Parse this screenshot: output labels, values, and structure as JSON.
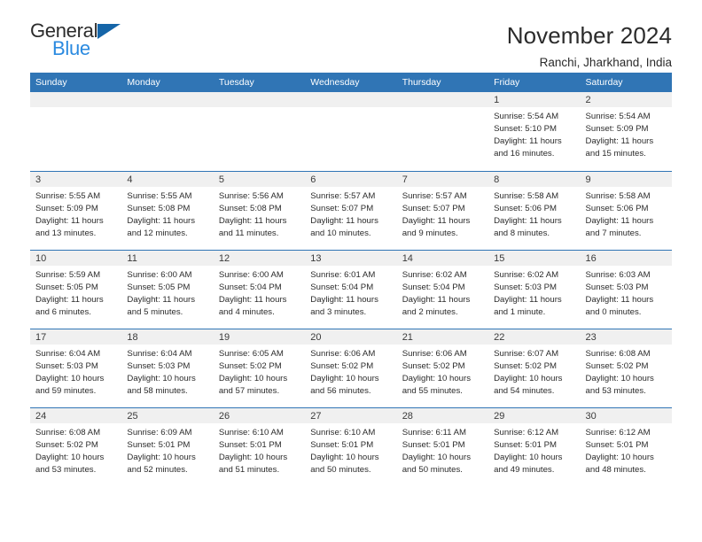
{
  "brand": {
    "name_part1": "General",
    "name_part2": "Blue",
    "triangle_color": "#1565a8",
    "blue_text_color": "#2b8ae0"
  },
  "header": {
    "title": "November 2024",
    "subtitle": "Ranchi, Jharkhand, India"
  },
  "theme": {
    "header_blue": "#3075b5",
    "daynum_band": "#f0f0f0",
    "text": "#2b2b2b"
  },
  "weekday_headers": [
    "Sunday",
    "Monday",
    "Tuesday",
    "Wednesday",
    "Thursday",
    "Friday",
    "Saturday"
  ],
  "weeks": [
    [
      {
        "day": "",
        "sunrise": "",
        "sunset": "",
        "daylight1": "",
        "daylight2": ""
      },
      {
        "day": "",
        "sunrise": "",
        "sunset": "",
        "daylight1": "",
        "daylight2": ""
      },
      {
        "day": "",
        "sunrise": "",
        "sunset": "",
        "daylight1": "",
        "daylight2": ""
      },
      {
        "day": "",
        "sunrise": "",
        "sunset": "",
        "daylight1": "",
        "daylight2": ""
      },
      {
        "day": "",
        "sunrise": "",
        "sunset": "",
        "daylight1": "",
        "daylight2": ""
      },
      {
        "day": "1",
        "sunrise": "Sunrise: 5:54 AM",
        "sunset": "Sunset: 5:10 PM",
        "daylight1": "Daylight: 11 hours",
        "daylight2": "and 16 minutes."
      },
      {
        "day": "2",
        "sunrise": "Sunrise: 5:54 AM",
        "sunset": "Sunset: 5:09 PM",
        "daylight1": "Daylight: 11 hours",
        "daylight2": "and 15 minutes."
      }
    ],
    [
      {
        "day": "3",
        "sunrise": "Sunrise: 5:55 AM",
        "sunset": "Sunset: 5:09 PM",
        "daylight1": "Daylight: 11 hours",
        "daylight2": "and 13 minutes."
      },
      {
        "day": "4",
        "sunrise": "Sunrise: 5:55 AM",
        "sunset": "Sunset: 5:08 PM",
        "daylight1": "Daylight: 11 hours",
        "daylight2": "and 12 minutes."
      },
      {
        "day": "5",
        "sunrise": "Sunrise: 5:56 AM",
        "sunset": "Sunset: 5:08 PM",
        "daylight1": "Daylight: 11 hours",
        "daylight2": "and 11 minutes."
      },
      {
        "day": "6",
        "sunrise": "Sunrise: 5:57 AM",
        "sunset": "Sunset: 5:07 PM",
        "daylight1": "Daylight: 11 hours",
        "daylight2": "and 10 minutes."
      },
      {
        "day": "7",
        "sunrise": "Sunrise: 5:57 AM",
        "sunset": "Sunset: 5:07 PM",
        "daylight1": "Daylight: 11 hours",
        "daylight2": "and 9 minutes."
      },
      {
        "day": "8",
        "sunrise": "Sunrise: 5:58 AM",
        "sunset": "Sunset: 5:06 PM",
        "daylight1": "Daylight: 11 hours",
        "daylight2": "and 8 minutes."
      },
      {
        "day": "9",
        "sunrise": "Sunrise: 5:58 AM",
        "sunset": "Sunset: 5:06 PM",
        "daylight1": "Daylight: 11 hours",
        "daylight2": "and 7 minutes."
      }
    ],
    [
      {
        "day": "10",
        "sunrise": "Sunrise: 5:59 AM",
        "sunset": "Sunset: 5:05 PM",
        "daylight1": "Daylight: 11 hours",
        "daylight2": "and 6 minutes."
      },
      {
        "day": "11",
        "sunrise": "Sunrise: 6:00 AM",
        "sunset": "Sunset: 5:05 PM",
        "daylight1": "Daylight: 11 hours",
        "daylight2": "and 5 minutes."
      },
      {
        "day": "12",
        "sunrise": "Sunrise: 6:00 AM",
        "sunset": "Sunset: 5:04 PM",
        "daylight1": "Daylight: 11 hours",
        "daylight2": "and 4 minutes."
      },
      {
        "day": "13",
        "sunrise": "Sunrise: 6:01 AM",
        "sunset": "Sunset: 5:04 PM",
        "daylight1": "Daylight: 11 hours",
        "daylight2": "and 3 minutes."
      },
      {
        "day": "14",
        "sunrise": "Sunrise: 6:02 AM",
        "sunset": "Sunset: 5:04 PM",
        "daylight1": "Daylight: 11 hours",
        "daylight2": "and 2 minutes."
      },
      {
        "day": "15",
        "sunrise": "Sunrise: 6:02 AM",
        "sunset": "Sunset: 5:03 PM",
        "daylight1": "Daylight: 11 hours",
        "daylight2": "and 1 minute."
      },
      {
        "day": "16",
        "sunrise": "Sunrise: 6:03 AM",
        "sunset": "Sunset: 5:03 PM",
        "daylight1": "Daylight: 11 hours",
        "daylight2": "and 0 minutes."
      }
    ],
    [
      {
        "day": "17",
        "sunrise": "Sunrise: 6:04 AM",
        "sunset": "Sunset: 5:03 PM",
        "daylight1": "Daylight: 10 hours",
        "daylight2": "and 59 minutes."
      },
      {
        "day": "18",
        "sunrise": "Sunrise: 6:04 AM",
        "sunset": "Sunset: 5:03 PM",
        "daylight1": "Daylight: 10 hours",
        "daylight2": "and 58 minutes."
      },
      {
        "day": "19",
        "sunrise": "Sunrise: 6:05 AM",
        "sunset": "Sunset: 5:02 PM",
        "daylight1": "Daylight: 10 hours",
        "daylight2": "and 57 minutes."
      },
      {
        "day": "20",
        "sunrise": "Sunrise: 6:06 AM",
        "sunset": "Sunset: 5:02 PM",
        "daylight1": "Daylight: 10 hours",
        "daylight2": "and 56 minutes."
      },
      {
        "day": "21",
        "sunrise": "Sunrise: 6:06 AM",
        "sunset": "Sunset: 5:02 PM",
        "daylight1": "Daylight: 10 hours",
        "daylight2": "and 55 minutes."
      },
      {
        "day": "22",
        "sunrise": "Sunrise: 6:07 AM",
        "sunset": "Sunset: 5:02 PM",
        "daylight1": "Daylight: 10 hours",
        "daylight2": "and 54 minutes."
      },
      {
        "day": "23",
        "sunrise": "Sunrise: 6:08 AM",
        "sunset": "Sunset: 5:02 PM",
        "daylight1": "Daylight: 10 hours",
        "daylight2": "and 53 minutes."
      }
    ],
    [
      {
        "day": "24",
        "sunrise": "Sunrise: 6:08 AM",
        "sunset": "Sunset: 5:02 PM",
        "daylight1": "Daylight: 10 hours",
        "daylight2": "and 53 minutes."
      },
      {
        "day": "25",
        "sunrise": "Sunrise: 6:09 AM",
        "sunset": "Sunset: 5:01 PM",
        "daylight1": "Daylight: 10 hours",
        "daylight2": "and 52 minutes."
      },
      {
        "day": "26",
        "sunrise": "Sunrise: 6:10 AM",
        "sunset": "Sunset: 5:01 PM",
        "daylight1": "Daylight: 10 hours",
        "daylight2": "and 51 minutes."
      },
      {
        "day": "27",
        "sunrise": "Sunrise: 6:10 AM",
        "sunset": "Sunset: 5:01 PM",
        "daylight1": "Daylight: 10 hours",
        "daylight2": "and 50 minutes."
      },
      {
        "day": "28",
        "sunrise": "Sunrise: 6:11 AM",
        "sunset": "Sunset: 5:01 PM",
        "daylight1": "Daylight: 10 hours",
        "daylight2": "and 50 minutes."
      },
      {
        "day": "29",
        "sunrise": "Sunrise: 6:12 AM",
        "sunset": "Sunset: 5:01 PM",
        "daylight1": "Daylight: 10 hours",
        "daylight2": "and 49 minutes."
      },
      {
        "day": "30",
        "sunrise": "Sunrise: 6:12 AM",
        "sunset": "Sunset: 5:01 PM",
        "daylight1": "Daylight: 10 hours",
        "daylight2": "and 48 minutes."
      }
    ]
  ]
}
